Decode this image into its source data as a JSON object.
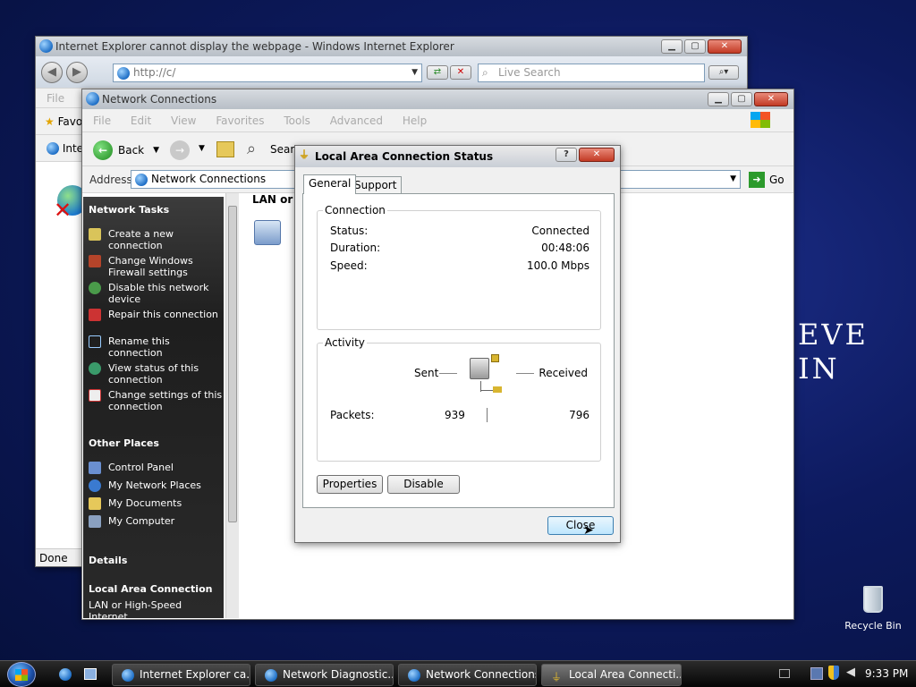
{
  "desktop": {
    "banner_text": "EVE IN",
    "recycle_bin_label": "Recycle Bin"
  },
  "ie_window": {
    "title": "Internet Explorer cannot display the webpage - Windows Internet Explorer",
    "address": "http://c/",
    "search_placeholder": "Live Search",
    "menu_file": "File",
    "favorites_label": "Favo",
    "tab_label": "Inte",
    "status": "Done"
  },
  "net_window": {
    "title": "Network Connections",
    "menu": [
      "File",
      "Edit",
      "View",
      "Favorites",
      "Tools",
      "Advanced",
      "Help"
    ],
    "back_label": "Back",
    "search_label": "Sear",
    "address_label": "Address",
    "address_value": "Network Connections",
    "go_label": "Go",
    "content_header": "LAN or H",
    "sidebar": {
      "network_tasks_title": "Network Tasks",
      "network_tasks": [
        "Create a new connection",
        "Change Windows Firewall settings",
        "Disable this network device",
        "Repair this connection",
        "Rename this connection",
        "View status of this connection",
        "Change settings of this connection"
      ],
      "other_places_title": "Other Places",
      "other_places": [
        "Control Panel",
        "My Network Places",
        "My Documents",
        "My Computer"
      ],
      "details_title": "Details",
      "details_name": "Local Area Connection",
      "details_sub": "LAN or High-Speed Internet"
    }
  },
  "dialog": {
    "title": "Local Area Connection Status",
    "help_button": "?",
    "tabs": [
      "General",
      "Support"
    ],
    "connection_group": "Connection",
    "status_label": "Status:",
    "status_value": "Connected",
    "duration_label": "Duration:",
    "duration_value": "00:48:06",
    "speed_label": "Speed:",
    "speed_value": "100.0 Mbps",
    "activity_group": "Activity",
    "sent_label": "Sent",
    "received_label": "Received",
    "packets_label": "Packets:",
    "packets_sent": "939",
    "packets_received": "796",
    "properties_button": "Properties",
    "disable_button": "Disable",
    "close_button": "Close"
  },
  "taskbar": {
    "tasks": [
      "Internet Explorer ca...",
      "Network Diagnostic...",
      "Network Connections",
      "Local Area Connecti..."
    ],
    "clock": "9:33 PM"
  }
}
